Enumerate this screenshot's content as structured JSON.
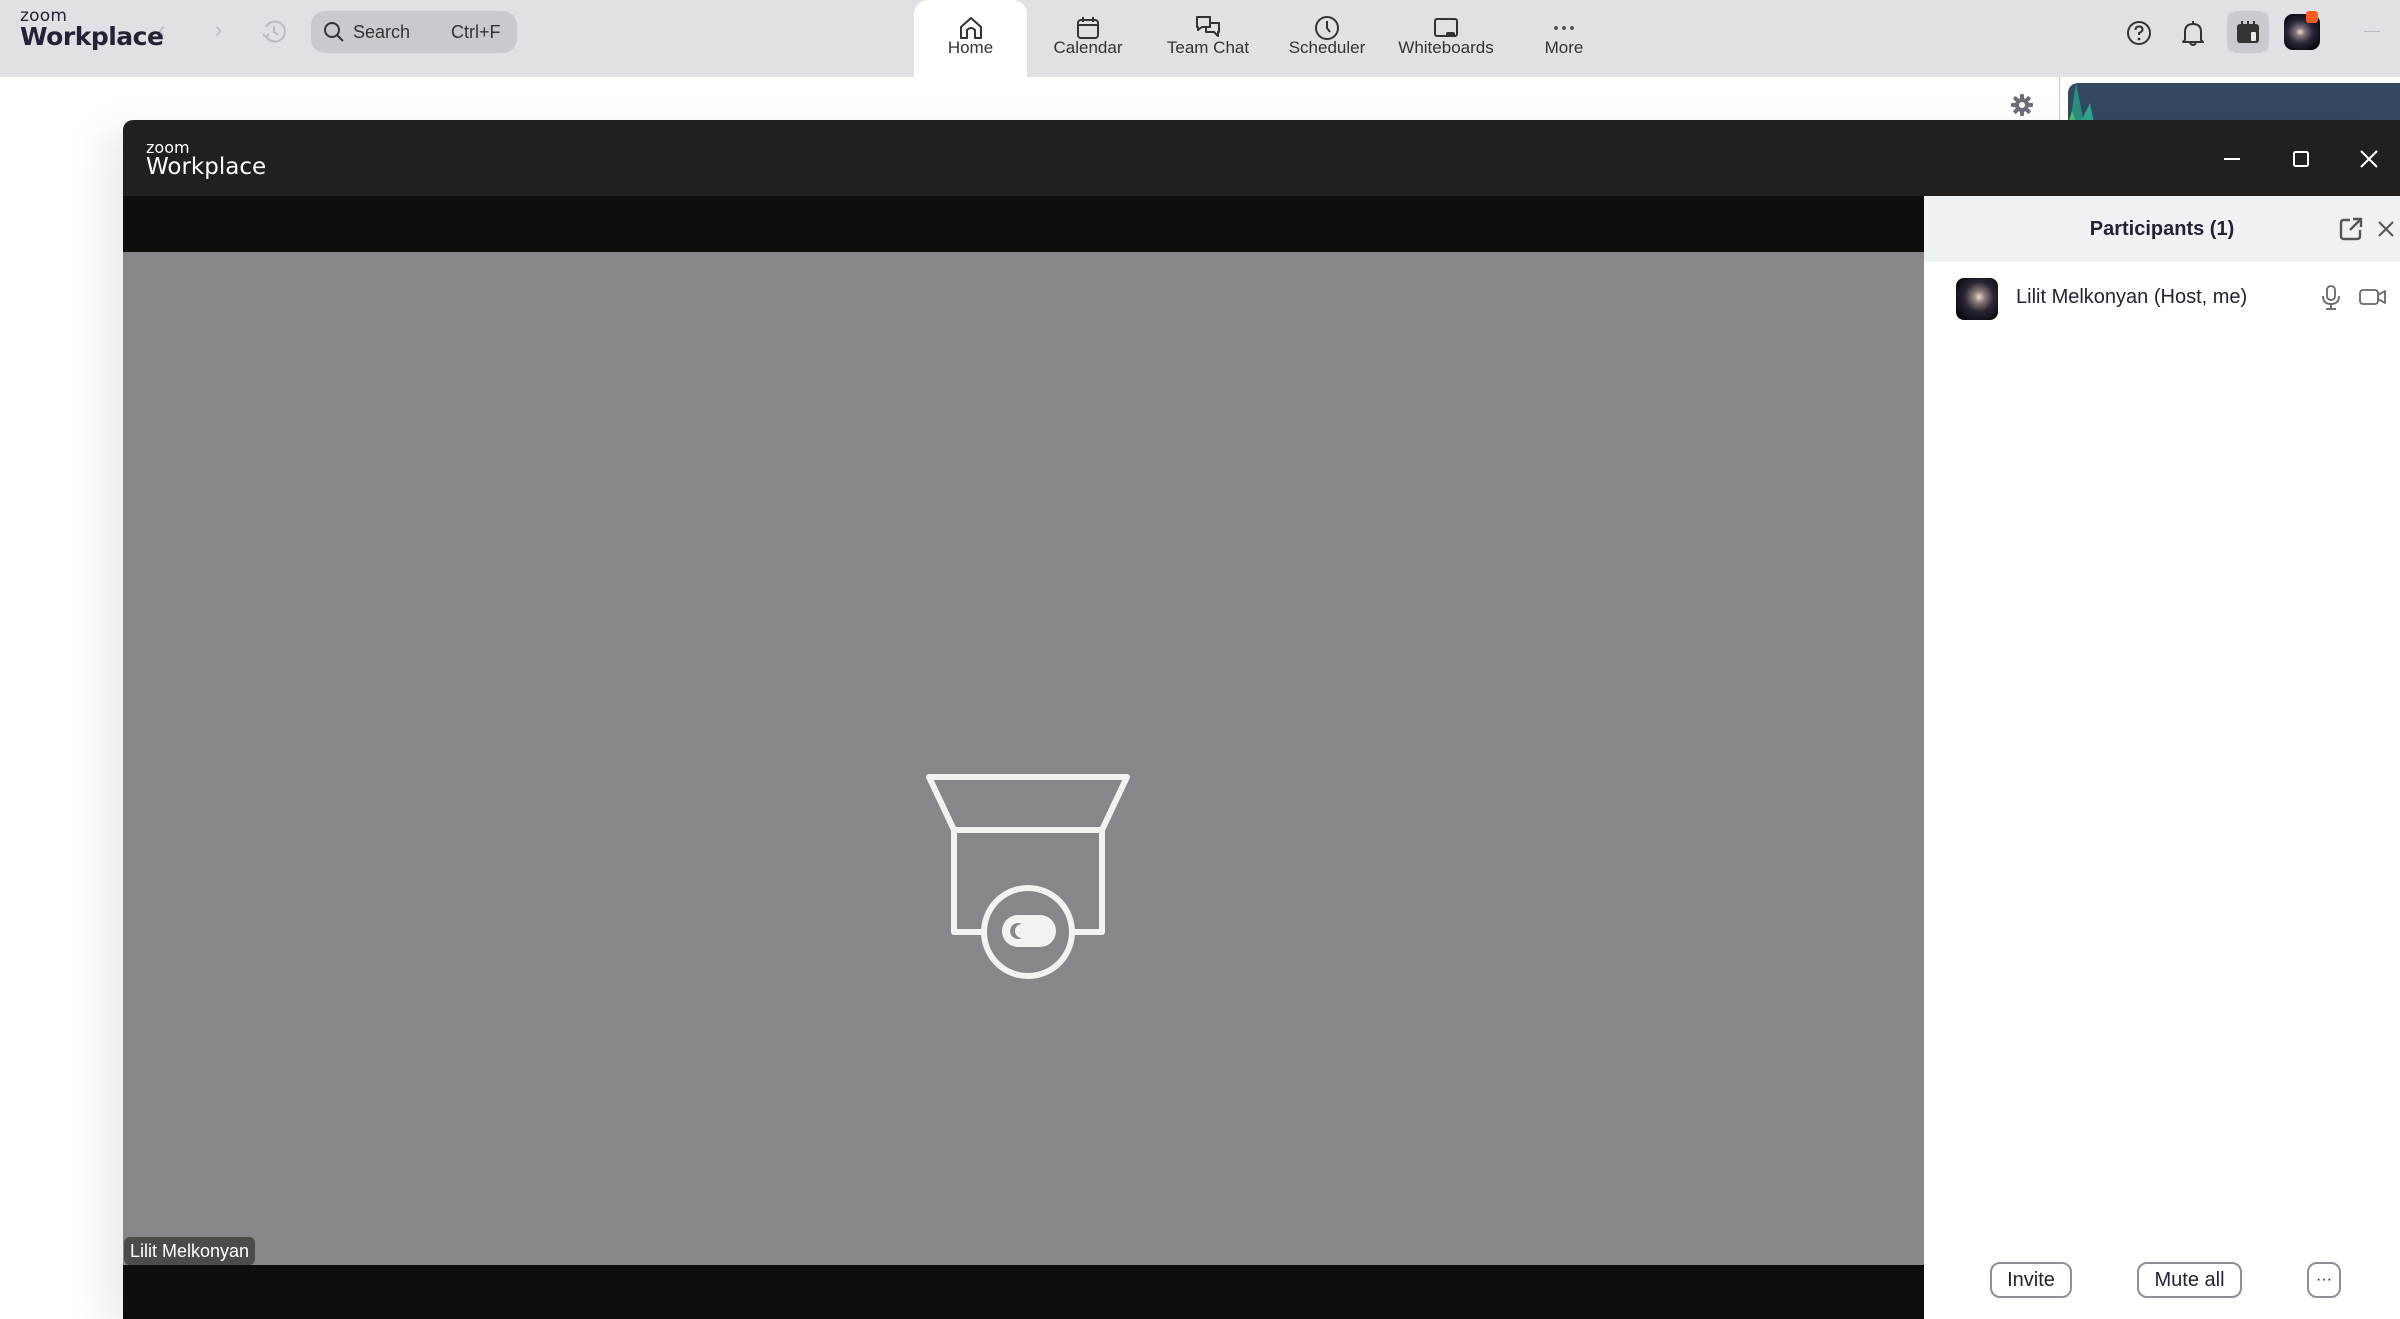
{
  "app": {
    "logo_small": "zoom",
    "logo_big": "Workplace"
  },
  "topnav": {
    "search": {
      "placeholder": "Search",
      "shortcut": "Ctrl+F"
    },
    "tabs": [
      {
        "label": "Home",
        "icon": "home-icon",
        "active": true
      },
      {
        "label": "Calendar",
        "icon": "calendar-icon",
        "active": false
      },
      {
        "label": "Team Chat",
        "icon": "chat-icon",
        "active": false
      },
      {
        "label": "Scheduler",
        "icon": "clock-icon",
        "active": false
      },
      {
        "label": "Whiteboards",
        "icon": "whiteboard-icon",
        "active": false
      },
      {
        "label": "More",
        "icon": "more-icon",
        "active": false
      }
    ],
    "right_icons": [
      "help-icon",
      "bell-icon",
      "calendar-app-icon",
      "avatar",
      "minimize-icon"
    ],
    "avatar_badge_color": "#ff5a1f"
  },
  "meeting": {
    "title_small": "zoom",
    "title_big": "Workplace",
    "window_controls": [
      "minimize",
      "maximize",
      "close"
    ],
    "video": {
      "background_color": "#88868b",
      "placeholder_icon": "camera-off-icon",
      "name_label": "Lilit Melkonyan"
    }
  },
  "participants": {
    "title": "Participants (1)",
    "list": [
      {
        "name": "Lilit Melkonyan (Host, me)",
        "mic": "microphone-icon",
        "video": "video-camera-icon"
      }
    ],
    "footer": {
      "invite": "Invite",
      "mute_all": "Mute all",
      "more": "···"
    }
  }
}
